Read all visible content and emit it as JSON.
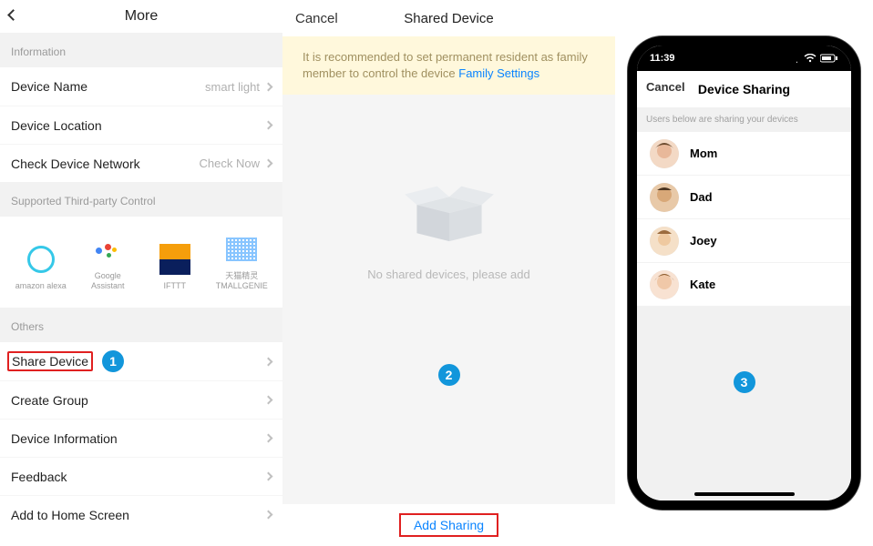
{
  "panel1": {
    "title": "More",
    "sections": {
      "information_label": "Information",
      "device_name_label": "Device Name",
      "device_name_value": "smart light",
      "device_location_label": "Device Location",
      "check_network_label": "Check Device Network",
      "check_network_value": "Check Now",
      "third_party_label": "Supported Third-party Control",
      "others_label": "Others"
    },
    "integrations": [
      {
        "name": "amazon alexa"
      },
      {
        "name": "Google Assistant"
      },
      {
        "name": "IFTTT"
      },
      {
        "name": "天猫精灵\nTMALLGENIE"
      }
    ],
    "others_items": [
      {
        "label": "Share Device",
        "highlighted": true
      },
      {
        "label": "Create Group"
      },
      {
        "label": "Device Information"
      },
      {
        "label": "Feedback"
      },
      {
        "label": "Add to Home Screen"
      }
    ],
    "badge": "1"
  },
  "panel2": {
    "cancel": "Cancel",
    "title": "Shared Device",
    "banner_text": "It is recommended to set permanent resident as family member to control the device ",
    "banner_link": "Family Settings",
    "empty_text": "No shared devices, please add",
    "add_button": "Add Sharing",
    "badge": "2"
  },
  "panel3": {
    "status_time": "11:39",
    "cancel": "Cancel",
    "title": "Device Sharing",
    "subhead": "Users below are sharing your devices",
    "users": [
      {
        "name": "Mom"
      },
      {
        "name": "Dad"
      },
      {
        "name": "Joey"
      },
      {
        "name": "Kate"
      }
    ],
    "badge": "3"
  }
}
